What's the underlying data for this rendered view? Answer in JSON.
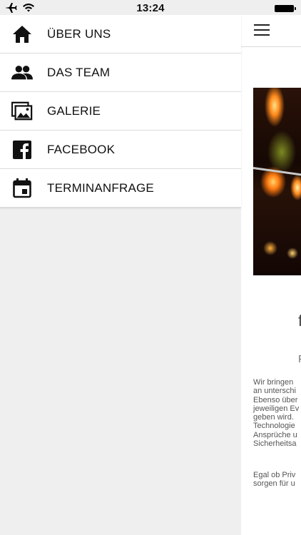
{
  "status_bar": {
    "time": "13:24",
    "icons": [
      "airplane-icon",
      "wifi-icon",
      "battery-icon"
    ]
  },
  "drawer": {
    "items": [
      {
        "label": "ÜBER UNS",
        "icon": "home-icon"
      },
      {
        "label": "DAS TEAM",
        "icon": "people-icon"
      },
      {
        "label": "GALERIE",
        "icon": "gallery-icon"
      },
      {
        "label": "FACEBOOK",
        "icon": "facebook-icon"
      },
      {
        "label": "TERMINANFRAGE",
        "icon": "calendar-icon"
      }
    ]
  },
  "content": {
    "menu_icon": "hamburger-icon",
    "heading": "f",
    "subheading": "F",
    "paragraph1": "Wir bringen\nan unterschi\nEbenso über\njeweiligen Ev\ngeben wird.\nTechnologie\nAnsprüche u\nSicherheitsa",
    "paragraph2": "Egal ob Priv\nsorgen für u"
  },
  "colors": {
    "background": "#efeff0",
    "menu_background": "#ffffff",
    "text": "#111111",
    "divider": "#dcdcdc"
  }
}
